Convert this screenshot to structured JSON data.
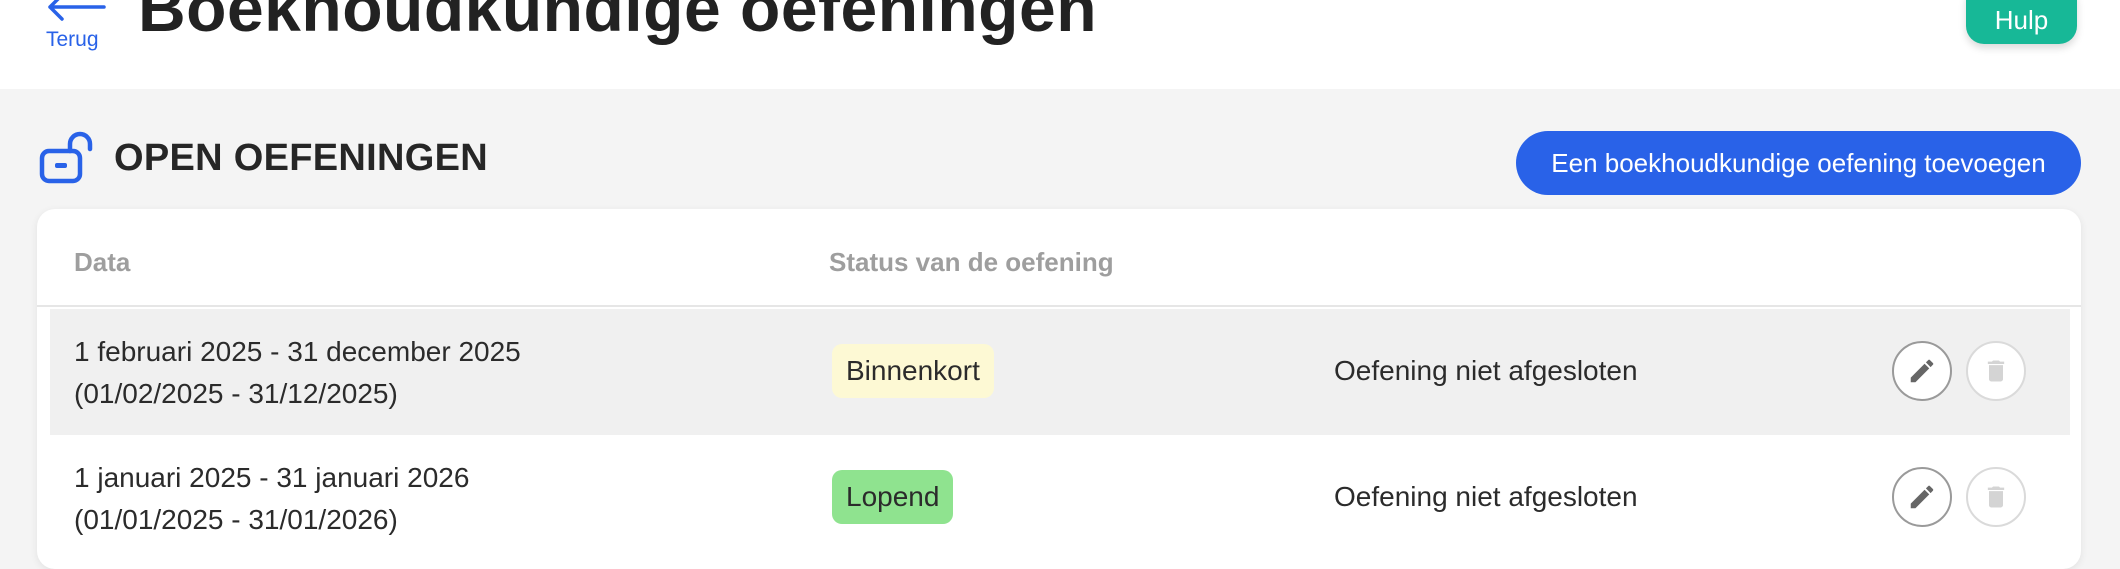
{
  "header": {
    "back_label": "Terug",
    "title": "Boekhoudkundige oefeningen",
    "help_label": "Hulp"
  },
  "section": {
    "icon": "unlock-icon",
    "title": "OPEN OEFENINGEN",
    "add_button_label": "Een boekhoudkundige oefening toevoegen"
  },
  "table": {
    "columns": [
      "Data",
      "Status van de oefening"
    ],
    "rows": [
      {
        "date_line1": "1 februari 2025 - 31 december 2025",
        "date_line2": "(01/02/2025 - 31/12/2025)",
        "status": "Binnenkort",
        "status_color": "#fdf9d4",
        "closing": "Oefening niet afgesloten",
        "actions": [
          "pencil-icon",
          "trash-icon"
        ]
      },
      {
        "date_line1": "1 januari 2025 - 31 januari 2026",
        "date_line2": "(01/01/2025 - 31/01/2026)",
        "status": "Lopend",
        "status_color": "#8fe38f",
        "closing": "Oefening niet afgesloten",
        "actions": [
          "pencil-icon",
          "trash-icon"
        ]
      }
    ]
  },
  "colors": {
    "accent_blue": "#2962e8",
    "help_green": "#17b897"
  }
}
